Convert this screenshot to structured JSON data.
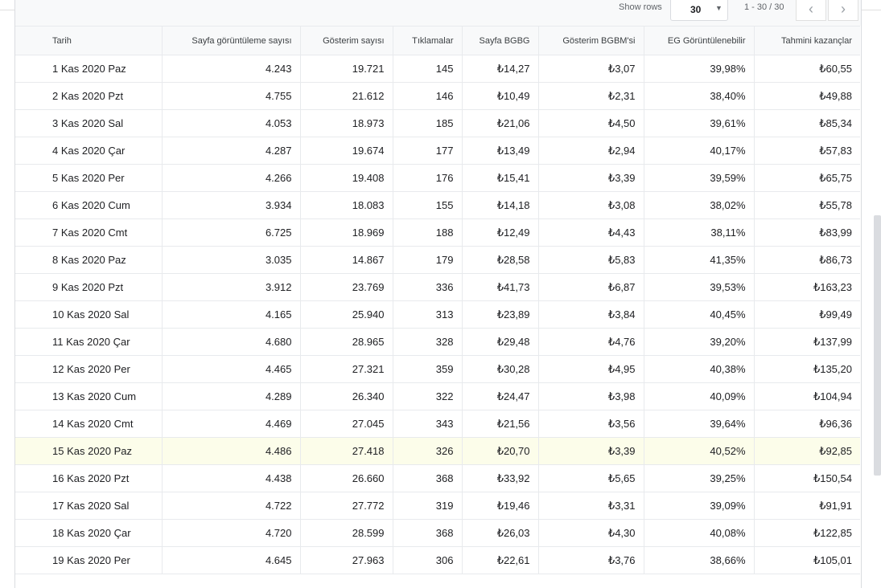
{
  "pager": {
    "show_rows_label": "Show rows",
    "rows_value": "30",
    "range_text": "1 - 30 / 30",
    "prev_icon": "‹",
    "next_icon": "›"
  },
  "table": {
    "headers": [
      "Tarih",
      "Sayfa görüntüleme sayısı",
      "Gösterim sayısı",
      "Tıklamalar",
      "Sayfa BGBG",
      "Gösterim BGBM'si",
      "EG Görüntülenebilir",
      "Tahmini kazançlar"
    ],
    "highlight_row_index": 14,
    "highlight_color": "#fcfdea",
    "rows": [
      [
        "1 Kas 2020 Paz",
        "4.243",
        "19.721",
        "145",
        "₺14,27",
        "₺3,07",
        "39,98%",
        "₺60,55"
      ],
      [
        "2 Kas 2020 Pzt",
        "4.755",
        "21.612",
        "146",
        "₺10,49",
        "₺2,31",
        "38,40%",
        "₺49,88"
      ],
      [
        "3 Kas 2020 Sal",
        "4.053",
        "18.973",
        "185",
        "₺21,06",
        "₺4,50",
        "39,61%",
        "₺85,34"
      ],
      [
        "4 Kas 2020 Çar",
        "4.287",
        "19.674",
        "177",
        "₺13,49",
        "₺2,94",
        "40,17%",
        "₺57,83"
      ],
      [
        "5 Kas 2020 Per",
        "4.266",
        "19.408",
        "176",
        "₺15,41",
        "₺3,39",
        "39,59%",
        "₺65,75"
      ],
      [
        "6 Kas 2020 Cum",
        "3.934",
        "18.083",
        "155",
        "₺14,18",
        "₺3,08",
        "38,02%",
        "₺55,78"
      ],
      [
        "7 Kas 2020 Cmt",
        "6.725",
        "18.969",
        "188",
        "₺12,49",
        "₺4,43",
        "38,11%",
        "₺83,99"
      ],
      [
        "8 Kas 2020 Paz",
        "3.035",
        "14.867",
        "179",
        "₺28,58",
        "₺5,83",
        "41,35%",
        "₺86,73"
      ],
      [
        "9 Kas 2020 Pzt",
        "3.912",
        "23.769",
        "336",
        "₺41,73",
        "₺6,87",
        "39,53%",
        "₺163,23"
      ],
      [
        "10 Kas 2020 Sal",
        "4.165",
        "25.940",
        "313",
        "₺23,89",
        "₺3,84",
        "40,45%",
        "₺99,49"
      ],
      [
        "11 Kas 2020 Çar",
        "4.680",
        "28.965",
        "328",
        "₺29,48",
        "₺4,76",
        "39,20%",
        "₺137,99"
      ],
      [
        "12 Kas 2020 Per",
        "4.465",
        "27.321",
        "359",
        "₺30,28",
        "₺4,95",
        "40,38%",
        "₺135,20"
      ],
      [
        "13 Kas 2020 Cum",
        "4.289",
        "26.340",
        "322",
        "₺24,47",
        "₺3,98",
        "40,09%",
        "₺104,94"
      ],
      [
        "14 Kas 2020 Cmt",
        "4.469",
        "27.045",
        "343",
        "₺21,56",
        "₺3,56",
        "39,64%",
        "₺96,36"
      ],
      [
        "15 Kas 2020 Paz",
        "4.486",
        "27.418",
        "326",
        "₺20,70",
        "₺3,39",
        "40,52%",
        "₺92,85"
      ],
      [
        "16 Kas 2020 Pzt",
        "4.438",
        "26.660",
        "368",
        "₺33,92",
        "₺5,65",
        "39,25%",
        "₺150,54"
      ],
      [
        "17 Kas 2020 Sal",
        "4.722",
        "27.772",
        "319",
        "₺19,46",
        "₺3,31",
        "39,09%",
        "₺91,91"
      ],
      [
        "18 Kas 2020 Çar",
        "4.720",
        "28.599",
        "368",
        "₺26,03",
        "₺4,30",
        "40,08%",
        "₺122,85"
      ],
      [
        "19 Kas 2020 Per",
        "4.645",
        "27.963",
        "306",
        "₺22,61",
        "₺3,76",
        "38,66%",
        "₺105,01"
      ]
    ]
  }
}
